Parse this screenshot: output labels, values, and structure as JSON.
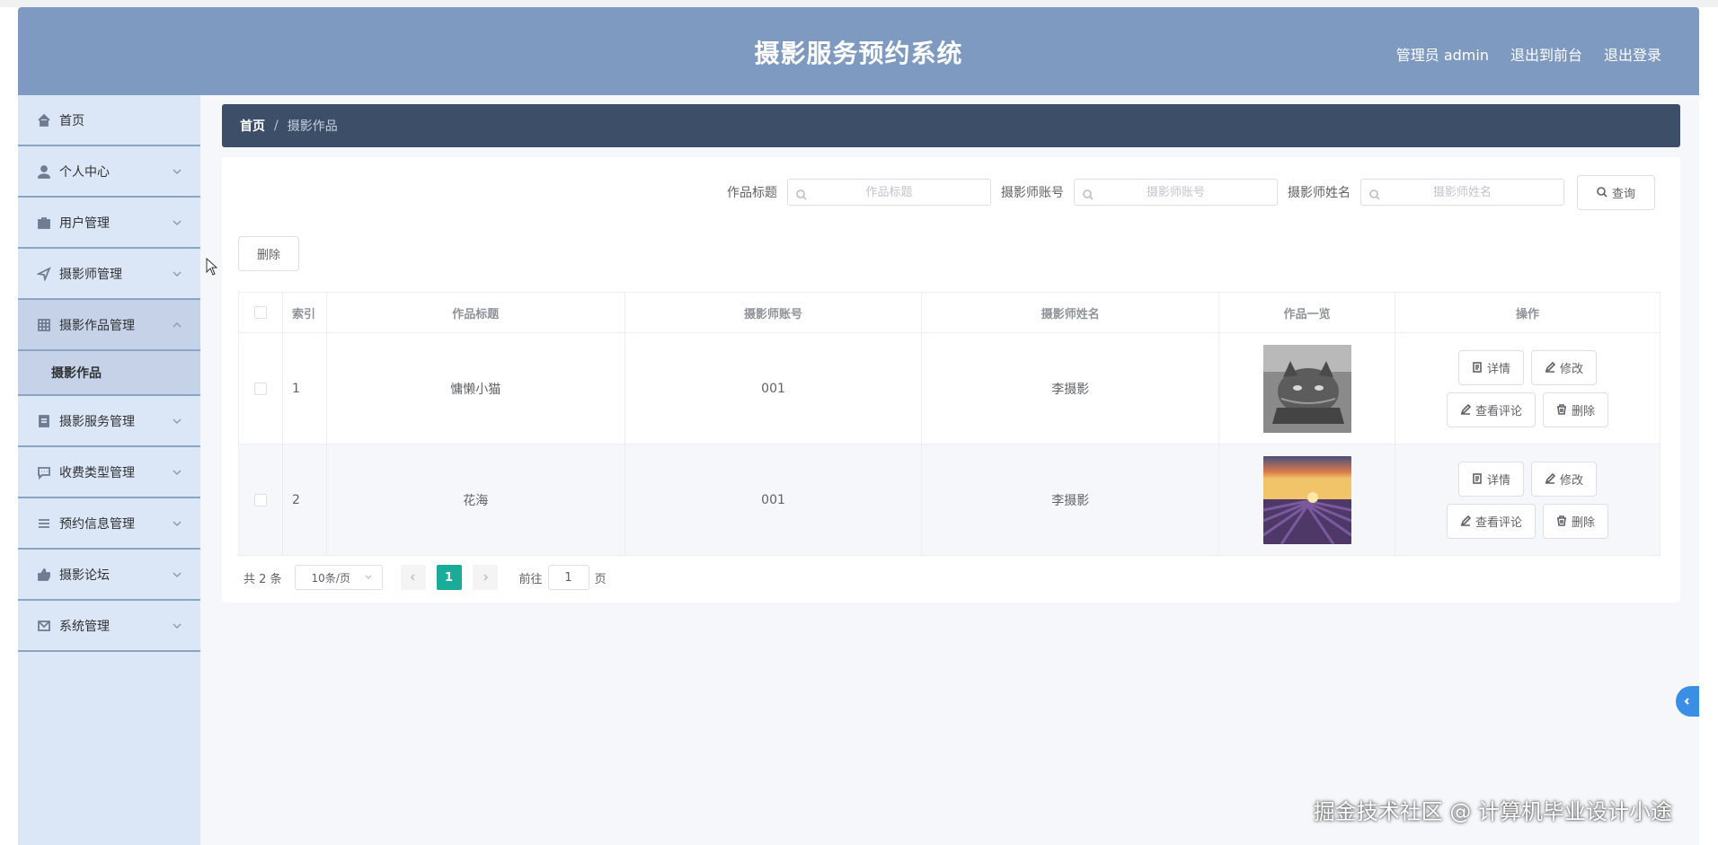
{
  "header": {
    "title": "摄影服务预约系统",
    "admin_label": "管理员 admin",
    "back_to_front": "退出到前台",
    "logout": "退出登录"
  },
  "sidebar": {
    "items": [
      {
        "label": "首页",
        "icon": "home-icon"
      },
      {
        "label": "个人中心",
        "icon": "user-icon"
      },
      {
        "label": "用户管理",
        "icon": "briefcase-icon"
      },
      {
        "label": "摄影师管理",
        "icon": "send-icon"
      },
      {
        "label": "摄影作品管理",
        "icon": "grid-icon"
      },
      {
        "label": "摄影服务管理",
        "icon": "clipboard-icon"
      },
      {
        "label": "收费类型管理",
        "icon": "chat-icon"
      },
      {
        "label": "预约信息管理",
        "icon": "list-icon"
      },
      {
        "label": "摄影论坛",
        "icon": "thumb-icon"
      },
      {
        "label": "系统管理",
        "icon": "mail-icon"
      }
    ],
    "submenu_label": "摄影作品"
  },
  "breadcrumb": {
    "home": "首页",
    "separator": "/",
    "current": "摄影作品"
  },
  "search": {
    "title_label": "作品标题",
    "title_placeholder": "作品标题",
    "account_label": "摄影师账号",
    "account_placeholder": "摄影师账号",
    "name_label": "摄影师姓名",
    "name_placeholder": "摄影师姓名",
    "query_button": "查询"
  },
  "toolbar": {
    "delete_button": "删除"
  },
  "table": {
    "headers": [
      "索引",
      "作品标题",
      "摄影师账号",
      "摄影师姓名",
      "作品一览",
      "操作"
    ],
    "rows": [
      {
        "index": "1",
        "title": "慵懒小猫",
        "account": "001",
        "name": "李摄影"
      },
      {
        "index": "2",
        "title": "花海",
        "account": "001",
        "name": "李摄影"
      }
    ],
    "actions": {
      "detail": "详情",
      "edit": "修改",
      "comments": "查看评论",
      "delete": "删除"
    }
  },
  "pagination": {
    "total": "共 2 条",
    "page_size": "10条/页",
    "current_page": "1",
    "goto_prefix": "前往",
    "goto_value": "1",
    "goto_suffix": "页"
  },
  "watermark": "掘金技术社区 @ 计算机毕业设计小途",
  "colors": {
    "header_bg": "#7f9ac0",
    "sidebar_bg": "#dbe6f6",
    "breadcrumb_bg": "#3d4e69",
    "accent": "#1bab99"
  }
}
